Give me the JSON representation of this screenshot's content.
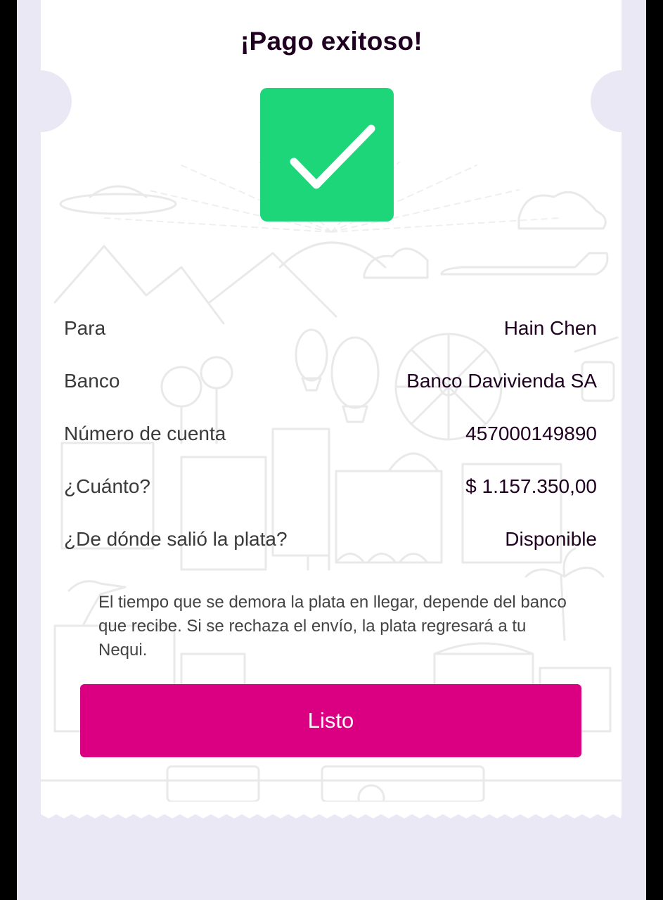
{
  "title": "¡Pago exitoso!",
  "status_icon": "check-icon",
  "details": [
    {
      "label": "Para",
      "value": "Hain Chen"
    },
    {
      "label": "Banco",
      "value": "Banco Davivienda SA"
    },
    {
      "label": "Número de cuenta",
      "value": "457000149890"
    },
    {
      "label": "¿Cuánto?",
      "value": "$ 1.157.350,00"
    },
    {
      "label": "¿De dónde salió la plata?",
      "value": "Disponible"
    }
  ],
  "note": "El tiempo que se demora la plata en llegar, depende del banco que recibe. Si se rechaza el envío, la plata regresará a tu Nequi.",
  "primary_button": {
    "label": "Listo"
  },
  "colors": {
    "success": "#1ed67a",
    "brand": "#da0081",
    "background": "#ebe8f5",
    "title": "#200020"
  }
}
